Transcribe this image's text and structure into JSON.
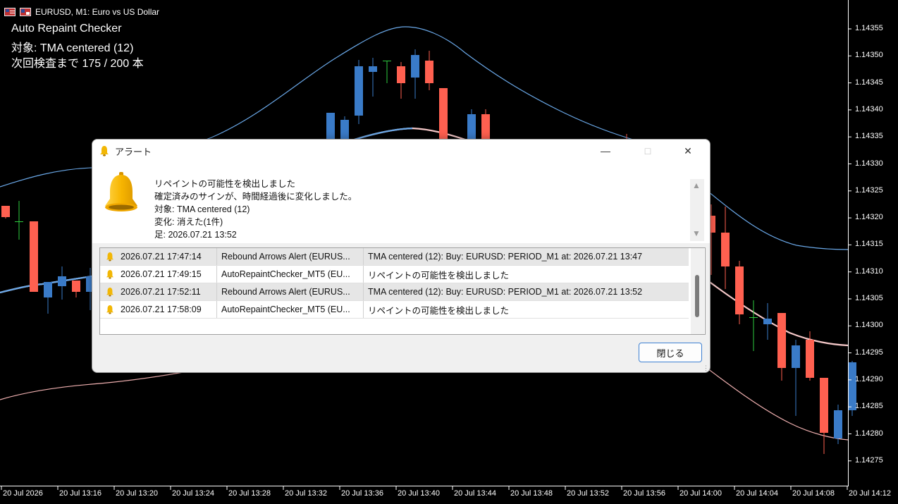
{
  "window": {
    "title": "EURUSD, M1:  Euro vs US Dollar"
  },
  "overlay": {
    "title": "Auto Repaint Checker",
    "target_line": "対象:  TMA centered (12)",
    "next_check": "次回検査まで 175 / 200 本"
  },
  "price_axis": [
    "1.14355",
    "1.14350",
    "1.14345",
    "1.14340",
    "1.14335",
    "1.14330",
    "1.14325",
    "1.14320",
    "1.14315",
    "1.14310",
    "1.14305",
    "1.14300",
    "1.14295",
    "1.14290",
    "1.14285",
    "1.14280",
    "1.14275"
  ],
  "time_axis": [
    "20 Jul 2026",
    "20 Jul 13:16",
    "20 Jul 13:20",
    "20 Jul 13:24",
    "20 Jul 13:28",
    "20 Jul 13:32",
    "20 Jul 13:36",
    "20 Jul 13:40",
    "20 Jul 13:44",
    "20 Jul 13:48",
    "20 Jul 13:52",
    "20 Jul 13:56",
    "20 Jul 14:00",
    "20 Jul 14:04",
    "20 Jul 14:08",
    "20 Jul 14:12"
  ],
  "colors": {
    "background": "#000000",
    "bull": "#3a7bc8",
    "bear": "#ff6050",
    "doji": "#2ecc40",
    "upper_band": "#6aa8e8",
    "lower_band": "#f0b0b0",
    "center_line": "#f6c9c9"
  },
  "dialog": {
    "title": "アラート",
    "icon": "bell-icon",
    "message_lines": [
      "リペイントの可能性を検出しました",
      "確定済みのサインが、時間経過後に変化しました。",
      "対象:  TMA centered (12)",
      "変化: 消えた(1件)",
      "足: 2026.07.21 13:52"
    ],
    "alerts": [
      {
        "time": "2026.07.21 17:47:14",
        "name": "Rebound Arrows Alert (EURUS...",
        "message": " TMA centered (12): Buy: EURUSD: PERIOD_M1 at: 2026.07.21 13:47",
        "selected": true
      },
      {
        "time": "2026.07.21 17:49:15",
        "name": "AutoRepaintChecker_MT5 (EU...",
        "message": "リペイントの可能性を検出しました",
        "selected": false
      },
      {
        "time": "2026.07.21 17:52:11",
        "name": "Rebound Arrows Alert (EURUS...",
        "message": " TMA centered (12): Buy: EURUSD: PERIOD_M1 at: 2026.07.21 13:52",
        "selected": true
      },
      {
        "time": "2026.07.21 17:58:09",
        "name": "AutoRepaintChecker_MT5 (EU...",
        "message": "リペイントの可能性を検出しました",
        "selected": false
      }
    ],
    "close_label": "閉じる"
  }
}
